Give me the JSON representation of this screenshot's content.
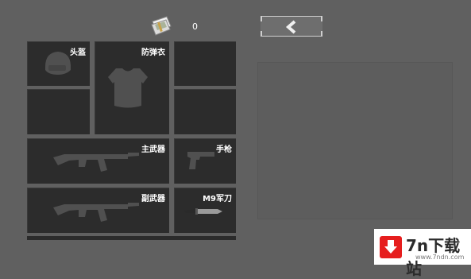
{
  "header": {
    "money_icon": "cash-stack-icon",
    "money_count": "0",
    "back_icon": "chevron-left-icon"
  },
  "slots": {
    "helmet": {
      "label": "头盔",
      "icon": "helmet-icon"
    },
    "armor": {
      "label": "防弹衣",
      "icon": "vest-icon"
    },
    "primary": {
      "label": "主武器",
      "icon": "rifle-icon"
    },
    "pistol": {
      "label": "手枪",
      "icon": "pistol-icon"
    },
    "secondary": {
      "label": "副武器",
      "icon": "rifle-icon"
    },
    "knife": {
      "label": "M9军刀",
      "icon": "knife-icon"
    }
  },
  "watermark": {
    "title": "7n下载站",
    "url": "www.7ndn.com"
  },
  "colors": {
    "background": "#606060",
    "slot": "#2c2c2c",
    "silhouette": "#505050",
    "panel": "#5d5d5d",
    "watermark_red": "#e61e1e"
  }
}
